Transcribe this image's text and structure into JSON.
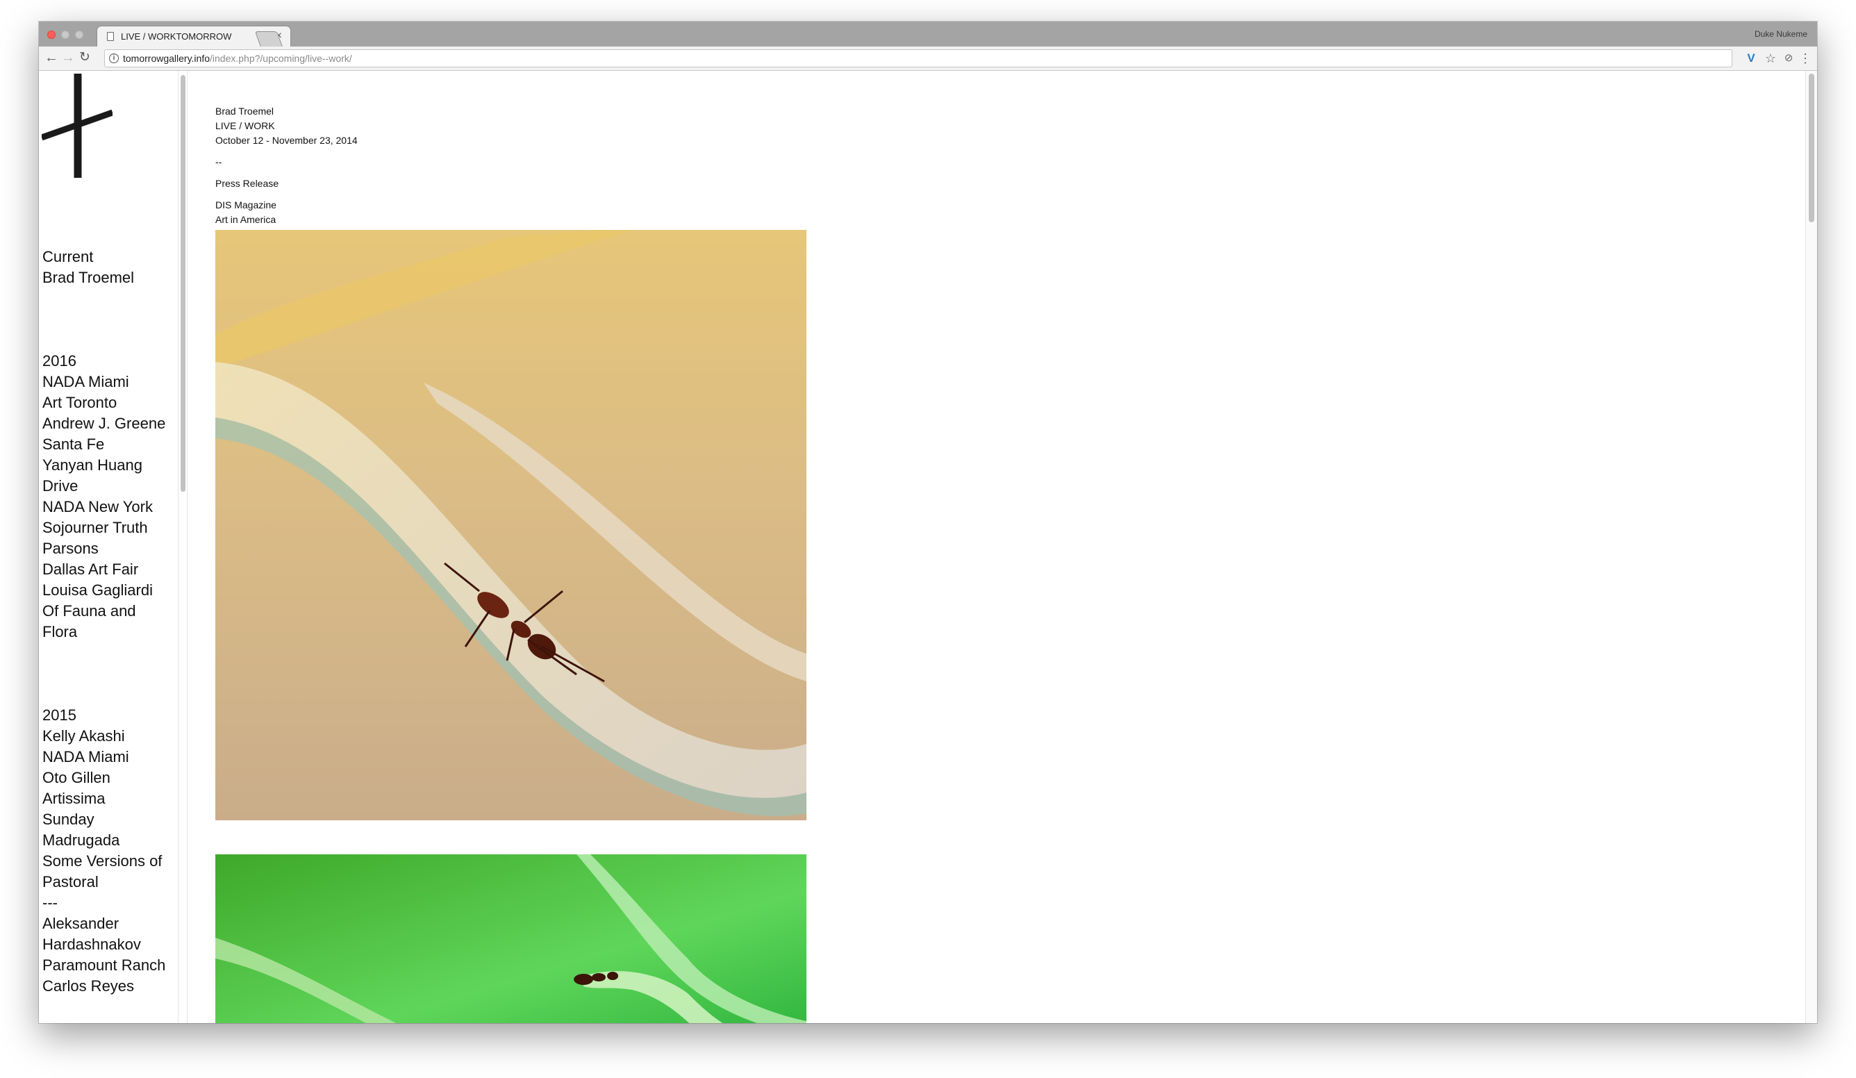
{
  "browser": {
    "tab_title": "LIVE / WORKTOMORROW",
    "tab_close": "×",
    "profile_name": "Duke Nukeme",
    "url_host": "tomorrowgallery.info",
    "url_path": "/index.php?/upcoming/live--work/",
    "icons": {
      "back": "←",
      "forward": "→",
      "reload": "↻",
      "info": "i",
      "extension": "V",
      "star": "☆",
      "extension2": "⊘",
      "menu": "⋮"
    }
  },
  "sidebar": {
    "current_heading": "Current",
    "current_items": [
      "Brad Troemel"
    ],
    "year_2016": "2016",
    "items_2016": [
      "NADA Miami",
      "Art Toronto",
      "Andrew J. Greene",
      "Santa Fe",
      "Yanyan Huang",
      "Drive",
      "NADA New York",
      "Sojourner Truth",
      "Parsons",
      "Dallas Art Fair",
      "Louisa Gagliardi",
      "Of Fauna and",
      "Flora"
    ],
    "year_2015": "2015",
    "items_2015": [
      "Kelly Akashi",
      "NADA Miami",
      "Oto Gillen",
      "Artissima",
      "Sunday",
      "Madrugada",
      "Some Versions of",
      "Pastoral",
      "---",
      "Aleksander",
      "Hardashnakov",
      "Paramount Ranch",
      "Carlos Reyes"
    ]
  },
  "exhibition": {
    "artist": "Brad Troemel",
    "title": "LIVE / WORK",
    "dates": "October 12 - November 23, 2014",
    "separator": "--",
    "press_release": "Press Release",
    "links": [
      "DIS Magazine",
      "Art in America"
    ]
  },
  "colors": {
    "window_chrome": "#a4a4a4",
    "toolbar": "#f2f2f2",
    "text": "#111111",
    "photo1_bg": "#d8b477",
    "photo2_bg": "#4fbf3a"
  }
}
